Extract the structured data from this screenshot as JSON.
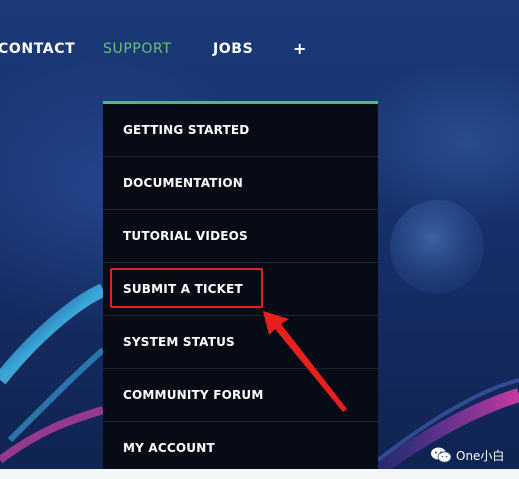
{
  "nav": {
    "items": [
      {
        "label": "CONTACT"
      },
      {
        "label": "SUPPORT",
        "active": true
      },
      {
        "label": "JOBS"
      },
      {
        "label": "+"
      }
    ],
    "active_color": "#66c27a"
  },
  "dropdown": {
    "accent_color": "#5cb86b",
    "items": [
      {
        "label": "GETTING STARTED"
      },
      {
        "label": "DOCUMENTATION"
      },
      {
        "label": "TUTORIAL VIDEOS"
      },
      {
        "label": "SUBMIT A TICKET",
        "highlighted": true
      },
      {
        "label": "SYSTEM STATUS"
      },
      {
        "label": "COMMUNITY FORUM"
      },
      {
        "label": "MY ACCOUNT"
      }
    ]
  },
  "annotation": {
    "highlight_color": "#e8201d",
    "arrow_icon": "red-arrow-icon"
  },
  "watermark": {
    "text": "One小白",
    "icon": "wechat-icon"
  }
}
